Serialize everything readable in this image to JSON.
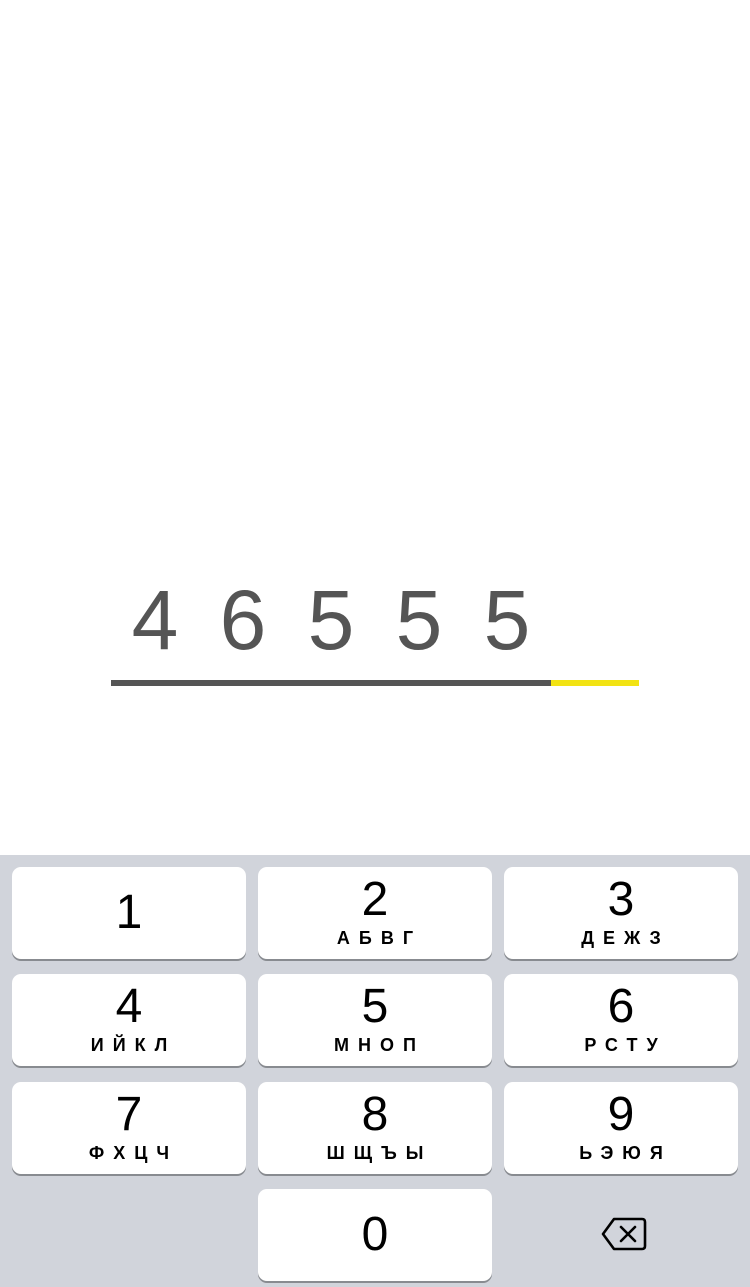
{
  "code_entry": {
    "digits": [
      "4",
      "6",
      "5",
      "5",
      "5",
      ""
    ],
    "filled_count": 5,
    "total_length": 6,
    "colors": {
      "digit_text": "#555555",
      "underline_filled": "#555555",
      "underline_empty": "#f2e313"
    }
  },
  "keypad": {
    "keys": [
      {
        "id": "1",
        "number": "1",
        "letters": ""
      },
      {
        "id": "2",
        "number": "2",
        "letters": "АБВГ"
      },
      {
        "id": "3",
        "number": "3",
        "letters": "ДЕЖЗ"
      },
      {
        "id": "4",
        "number": "4",
        "letters": "ИЙКЛ"
      },
      {
        "id": "5",
        "number": "5",
        "letters": "МНОП"
      },
      {
        "id": "6",
        "number": "6",
        "letters": "РСТУ"
      },
      {
        "id": "7",
        "number": "7",
        "letters": "ФХЦЧ"
      },
      {
        "id": "8",
        "number": "8",
        "letters": "ШЩЪЫ"
      },
      {
        "id": "9",
        "number": "9",
        "letters": "ЬЭЮЯ"
      },
      {
        "id": "0",
        "number": "0",
        "letters": ""
      }
    ],
    "backspace_icon": "backspace-icon",
    "colors": {
      "background": "#d1d4db",
      "key": "#ffffff",
      "key_shadow": "#888b90",
      "text": "#000000"
    }
  }
}
